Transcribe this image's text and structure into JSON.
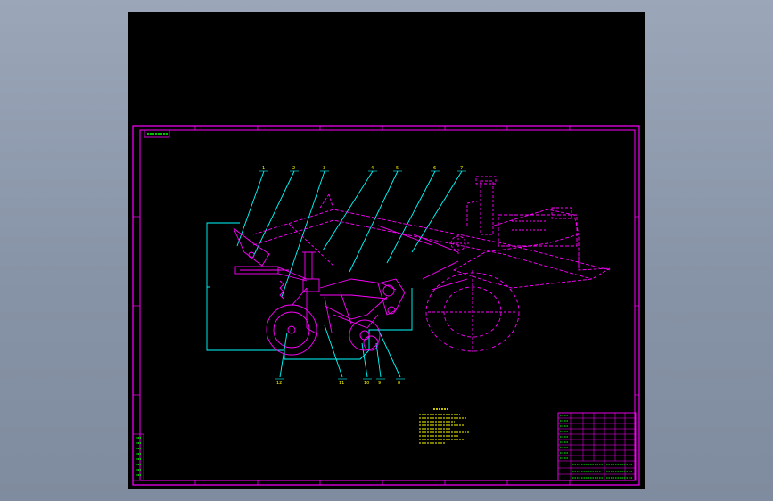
{
  "viewer": {
    "background": "#8a96a9",
    "canvas_color": "#000000"
  },
  "drawing": {
    "frame_color": "#ff00ff",
    "leader_color": "#00ffff",
    "part_color": "#ff00ff",
    "note_color": "#ffff00",
    "title_block_color": "#00ff00",
    "balloons": [
      "1",
      "2",
      "3",
      "4",
      "5",
      "6",
      "7"
    ],
    "balloons_bottom": [
      "12",
      "11",
      "10",
      "9",
      "8"
    ],
    "icons": [
      "front-wheel-icon",
      "rear-wheel-icon",
      "drive-wheel-icon",
      "engine-block-icon"
    ]
  }
}
